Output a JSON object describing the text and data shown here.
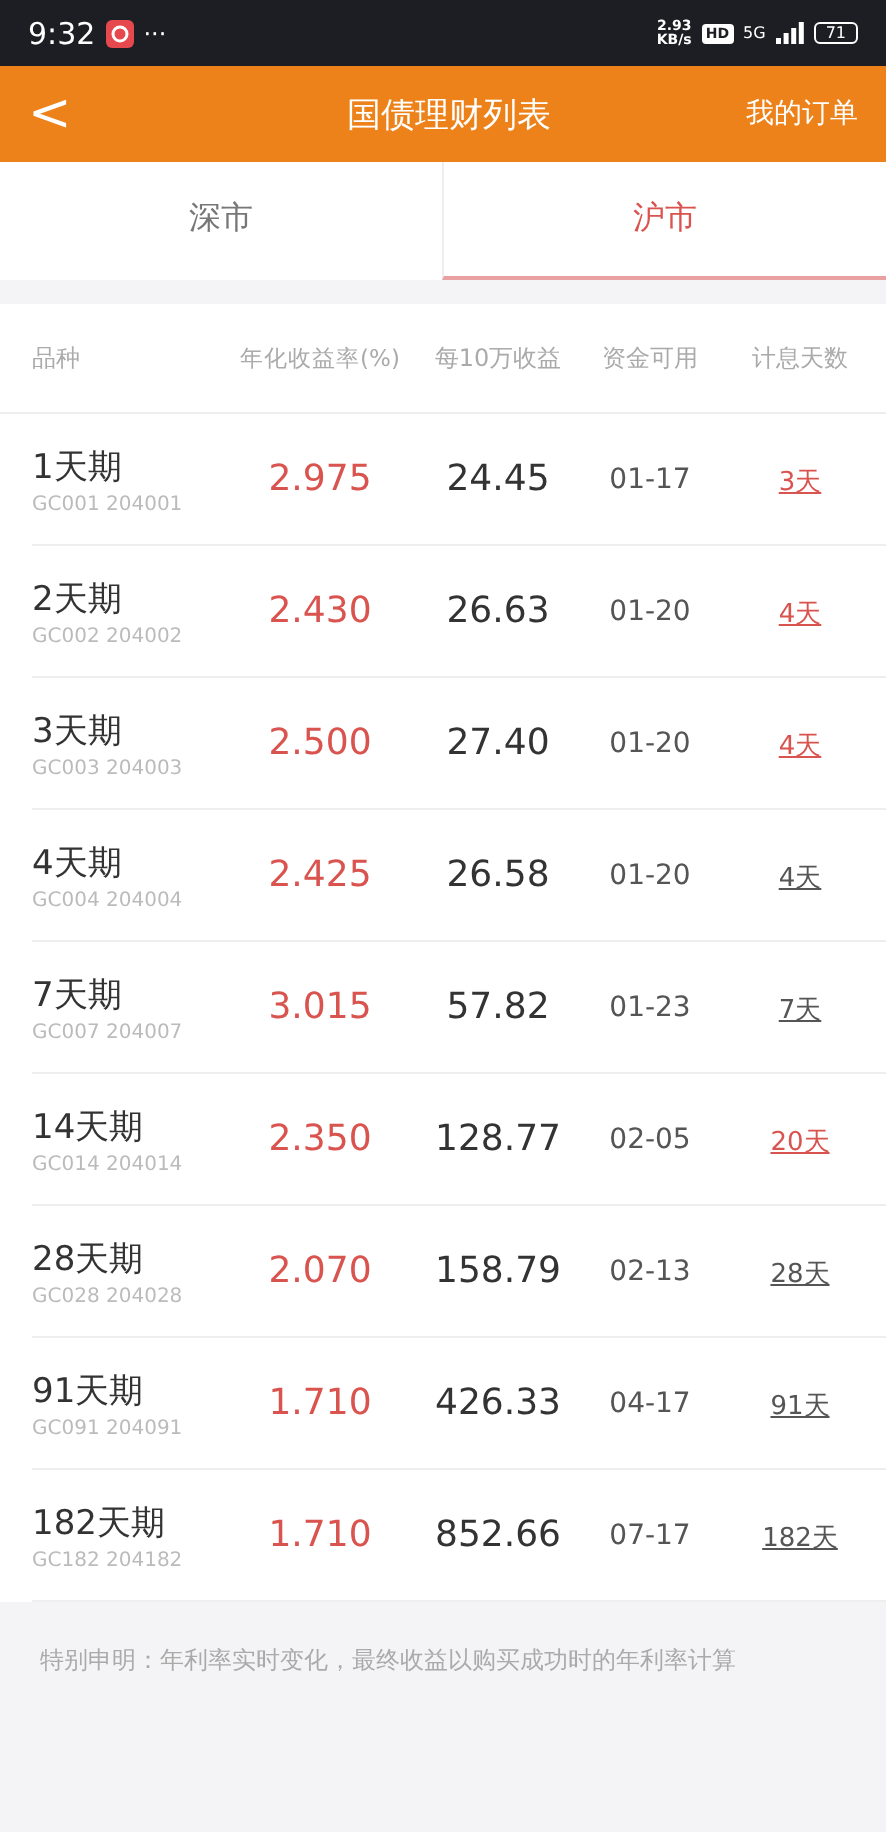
{
  "status_bar": {
    "time": "9:32",
    "dots": "···",
    "speed": "2.93\nKB/s",
    "hd": "HD",
    "network": "5G",
    "battery": "71"
  },
  "header": {
    "back": "<",
    "title": "国债理财列表",
    "action": "我的订单"
  },
  "tabs": [
    {
      "label": "深市",
      "selected": false
    },
    {
      "label": "沪市",
      "selected": true
    }
  ],
  "table": {
    "columns": [
      "品种",
      "年化收益率(%)",
      "每10万收益",
      "资金可用",
      "计息天数"
    ],
    "rows": [
      {
        "name": "1天期",
        "code": "GC001 204001",
        "rate": "2.975",
        "income": "24.45",
        "available": "01-17",
        "days": "3天",
        "color": "#d9534f"
      },
      {
        "name": "2天期",
        "code": "GC002 204002",
        "rate": "2.430",
        "income": "26.63",
        "available": "01-20",
        "days": "4天",
        "color": "#d9534f"
      },
      {
        "name": "3天期",
        "code": "GC003 204003",
        "rate": "2.500",
        "income": "27.40",
        "available": "01-20",
        "days": "4天",
        "color": "#d9534f"
      },
      {
        "name": "4天期",
        "code": "GC004 204004",
        "rate": "2.425",
        "income": "26.58",
        "available": "01-20",
        "days": "4天",
        "color": "#555555"
      },
      {
        "name": "7天期",
        "code": "GC007 204007",
        "rate": "3.015",
        "income": "57.82",
        "available": "01-23",
        "days": "7天",
        "color": "#555555"
      },
      {
        "name": "14天期",
        "code": "GC014 204014",
        "rate": "2.350",
        "income": "128.77",
        "available": "02-05",
        "days": "20天",
        "color": "#d9534f"
      },
      {
        "name": "28天期",
        "code": "GC028 204028",
        "rate": "2.070",
        "income": "158.79",
        "available": "02-13",
        "days": "28天",
        "color": "#555555"
      },
      {
        "name": "91天期",
        "code": "GC091 204091",
        "rate": "1.710",
        "income": "426.33",
        "available": "04-17",
        "days": "91天",
        "color": "#555555"
      },
      {
        "name": "182天期",
        "code": "GC182 204182",
        "rate": "1.710",
        "income": "852.66",
        "available": "07-17",
        "days": "182天",
        "color": "#555555"
      }
    ]
  },
  "note": "特别申明：年利率实时变化，最终收益以购买成功时的年利率计算"
}
